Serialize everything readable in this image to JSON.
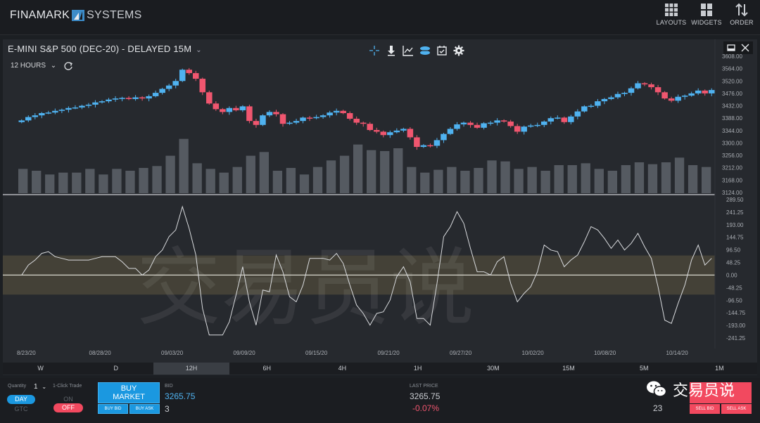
{
  "app": {
    "brand_left": "FINAMARK",
    "brand_right": "SYSTEMS",
    "nav": [
      {
        "label": "LAYOUTS",
        "icon": "layouts-icon"
      },
      {
        "label": "WIDGETS",
        "icon": "widgets-icon"
      },
      {
        "label": "ORDER",
        "icon": "order-icon"
      }
    ]
  },
  "chart": {
    "title": "E-MINI S&P 500 (DEC-20) - DELAYED 15M",
    "interval": "12 HOURS",
    "tools": [
      "crosshair-icon",
      "download-icon",
      "line-chart-icon",
      "layers-icon",
      "calendar-icon",
      "gear-icon"
    ]
  },
  "chart_data": [
    {
      "type": "candlestick",
      "y_ticks": [
        "3608.00",
        "3564.00",
        "3520.00",
        "3476.00",
        "3432.00",
        "3388.00",
        "3344.00",
        "3300.00",
        "3256.00",
        "3212.00",
        "3168.00",
        "3124.00"
      ],
      "x_ticks": [
        "8/23/20",
        "08/28/20",
        "09/03/20",
        "09/09/20",
        "09/15/20",
        "09/21/20",
        "09/27/20",
        "10/02/20",
        "10/08/20",
        "10/14/20"
      ],
      "close": [
        3380,
        3392,
        3398,
        3406,
        3408,
        3414,
        3418,
        3424,
        3426,
        3432,
        3436,
        3444,
        3448,
        3454,
        3458,
        3460,
        3456,
        3462,
        3458,
        3466,
        3478,
        3492,
        3504,
        3520,
        3560,
        3548,
        3528,
        3480,
        3440,
        3420,
        3410,
        3424,
        3416,
        3430,
        3378,
        3364,
        3398,
        3410,
        3402,
        3368,
        3372,
        3378,
        3390,
        3388,
        3392,
        3398,
        3408,
        3414,
        3406,
        3386,
        3372,
        3368,
        3346,
        3340,
        3328,
        3338,
        3344,
        3350,
        3320,
        3286,
        3292,
        3290,
        3310,
        3332,
        3350,
        3366,
        3372,
        3364,
        3354,
        3370,
        3372,
        3380,
        3376,
        3360,
        3340,
        3358,
        3362,
        3364,
        3376,
        3388,
        3390,
        3374,
        3394,
        3412,
        3430,
        3432,
        3448,
        3456,
        3462,
        3474,
        3478,
        3494,
        3512,
        3508,
        3498,
        3480,
        3458,
        3450,
        3464,
        3468,
        3476,
        3486,
        3476,
        3488
      ],
      "volume": [
        26,
        26,
        24,
        27,
        20,
        25,
        22,
        28,
        22,
        24,
        26,
        30,
        20,
        23,
        26,
        22,
        24,
        30,
        27,
        33,
        29,
        35,
        40,
        50,
        58,
        58,
        32,
        28,
        26,
        25,
        22,
        24,
        28,
        30,
        40,
        45,
        44,
        40,
        24,
        22,
        27,
        30,
        20,
        22,
        28,
        30,
        35,
        38,
        40,
        44,
        52,
        38,
        46,
        60,
        45,
        32,
        48,
        30,
        28,
        20,
        22,
        26,
        25,
        30,
        28,
        26,
        24,
        22,
        27,
        30,
        35,
        38,
        34,
        33,
        26,
        27,
        28,
        26,
        24,
        22,
        30,
        35,
        30,
        36,
        32,
        28,
        26,
        25,
        24,
        27,
        30,
        38,
        33,
        30,
        31,
        34,
        33,
        32,
        38,
        36,
        30,
        22,
        28,
        30
      ],
      "oscillator_y_ticks": [
        "289.50",
        "241.25",
        "193.00",
        "144.75",
        "96.50",
        "48.25",
        "0.00",
        "-48.25",
        "-96.50",
        "-144.75",
        "-193.00",
        "-241.25"
      ]
    }
  ],
  "timeframes": [
    "W",
    "D",
    "12H",
    "6H",
    "4H",
    "1H",
    "30M",
    "15M",
    "5M",
    "1M"
  ],
  "active_timeframe": "12H",
  "trade": {
    "quantity_label": "Quantity",
    "quantity": "1",
    "day_label": "DAY",
    "gtc_label": "GTC",
    "one_click_label": "1-Click Trade",
    "on_label": "ON",
    "off_label": "OFF",
    "buy_market": "BUY\nMARKET",
    "buy_line1": "BUY",
    "buy_line2": "MARKET",
    "buy_bid": "BUY BID",
    "buy_ask": "BUY ASK",
    "bid_label": "BID",
    "bid_price": "3265.75",
    "bid_size": "3",
    "last_label": "LAST PRICE",
    "last_price": "3265.75",
    "last_change": "-0.07%",
    "ask_size": "23",
    "sell_bid": "SELL BID",
    "sell_ask": "SELL ASK"
  },
  "watermark": {
    "text": "交易员说",
    "big_text": "交易员说"
  },
  "colors": {
    "up": "#4fb2f0",
    "down": "#f0566f",
    "volume": "#555a61",
    "band": "#5c5540"
  }
}
